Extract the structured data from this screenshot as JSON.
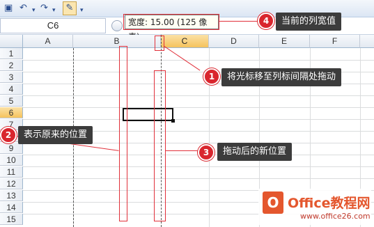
{
  "toolbar": {
    "icons": [
      "save-icon",
      "undo-icon",
      "redo-icon",
      "format-icon",
      "customize-icon"
    ]
  },
  "formula_bar": {
    "name_box": "C6",
    "tooltip": "宽度: 15.00 (125 像素)"
  },
  "sheet": {
    "columns": [
      "A",
      "B",
      "C",
      "D",
      "E",
      "F"
    ],
    "rows": [
      "1",
      "2",
      "3",
      "4",
      "5",
      "6",
      "7",
      "8",
      "9",
      "10",
      "11",
      "12",
      "13",
      "14",
      "15"
    ],
    "selected_cell": "C6"
  },
  "annotations": [
    {
      "number": "1",
      "text": "将光标移至列标间隔处拖动"
    },
    {
      "number": "2",
      "text": "表示原来的位置"
    },
    {
      "number": "3",
      "text": "拖动后的新位置"
    },
    {
      "number": "4",
      "text": "当前的列宽值"
    }
  ],
  "watermark": {
    "brand": "Office教程网",
    "url": "www.office26.com"
  }
}
